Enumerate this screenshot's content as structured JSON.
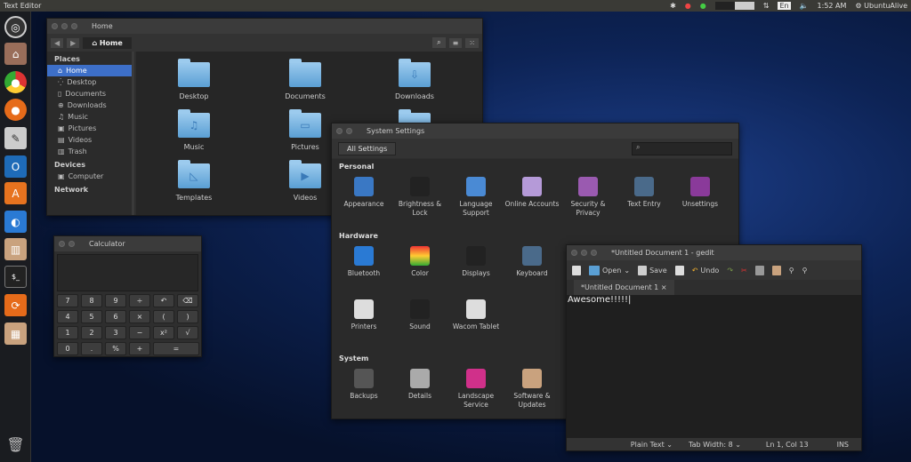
{
  "topbar": {
    "app_title": "Text Editor",
    "keyboard": "En",
    "clock": "1:52 AM",
    "user": "UbuntuAlive"
  },
  "launcher": {
    "items": [
      "ubuntu-dash",
      "files",
      "chrome",
      "firefox",
      "text-editor",
      "outlook",
      "software-center",
      "settings",
      "system-monitor",
      "terminal",
      "update-manager",
      "calculator",
      "trash"
    ]
  },
  "files": {
    "title": "Home",
    "path": "Home",
    "sidebar": {
      "places_header": "Places",
      "places": [
        "Home",
        "Desktop",
        "Documents",
        "Downloads",
        "Music",
        "Pictures",
        "Videos",
        "Trash"
      ],
      "devices_header": "Devices",
      "devices": [
        "Computer"
      ],
      "network_header": "Network"
    },
    "folders": [
      "Desktop",
      "Documents",
      "Downloads",
      "Music",
      "Pictures",
      "",
      "Templates",
      "Videos"
    ]
  },
  "calculator": {
    "title": "Calculator",
    "display": "",
    "keys": [
      [
        "7",
        "8",
        "9",
        "÷",
        "↶",
        "⌫"
      ],
      [
        "4",
        "5",
        "6",
        "×",
        "(",
        ")"
      ],
      [
        "1",
        "2",
        "3",
        "−",
        "x²",
        "√"
      ],
      [
        "0",
        ".",
        "%",
        "+",
        "="
      ]
    ]
  },
  "settings": {
    "title": "System Settings",
    "all_settings": "All Settings",
    "search_placeholder": "",
    "sections": [
      {
        "name": "Personal",
        "items": [
          "Appearance",
          "Brightness & Lock",
          "Language Support",
          "Online Accounts",
          "Security & Privacy",
          "Text Entry",
          "Unsettings"
        ]
      },
      {
        "name": "Hardware",
        "items": [
          "Bluetooth",
          "Color",
          "Displays",
          "Keyboard",
          "Printers",
          "Sound",
          "Wacom Tablet"
        ]
      },
      {
        "name": "System",
        "items": [
          "Backups",
          "Details",
          "Landscape Service",
          "Software & Updates"
        ]
      }
    ]
  },
  "gedit": {
    "title": "*Untitled Document 1 - gedit",
    "open": "Open",
    "save": "Save",
    "undo": "Undo",
    "tab": "*Untitled Document 1",
    "content": "Awesome!!!!!",
    "status": {
      "language": "Plain Text",
      "tab_width": "Tab Width: 8",
      "position": "Ln 1, Col 13",
      "mode": "INS"
    }
  }
}
